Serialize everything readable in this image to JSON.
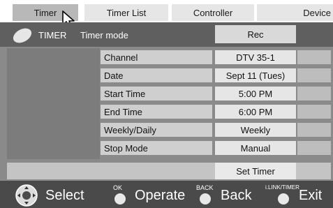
{
  "tabs": [
    {
      "label": "Timer"
    },
    {
      "label": "Timer List"
    },
    {
      "label": "Controller"
    },
    {
      "label": "Device"
    }
  ],
  "header": {
    "title": "TIMER",
    "mode_label": "Timer mode",
    "mode_value": "Rec"
  },
  "rows": [
    {
      "label": "Channel",
      "value": "DTV 35-1"
    },
    {
      "label": "Date",
      "value": "Sept 11 (Tues)"
    },
    {
      "label": "Start Time",
      "value": "5:00 PM"
    },
    {
      "label": "End Time",
      "value": "6:00 PM"
    },
    {
      "label": "Weekly/Daily",
      "value": "Weekly"
    },
    {
      "label": "Stop Mode",
      "value": "Manual"
    }
  ],
  "set_timer_label": "Set Timer",
  "footer": {
    "select_label": "Select",
    "ok_label": "OK",
    "operate_label": "Operate",
    "back_small": "BACK",
    "back_label": "Back",
    "ilink_small": "i.LINK/TIMER",
    "exit_label": "Exit"
  },
  "colors": {
    "background": "#5b5b5b",
    "panel": "#8a8a8a",
    "label_cell": "#cfcfcf",
    "value_cell": "#e6e6e6",
    "tab_active": "#b8b8b8"
  }
}
